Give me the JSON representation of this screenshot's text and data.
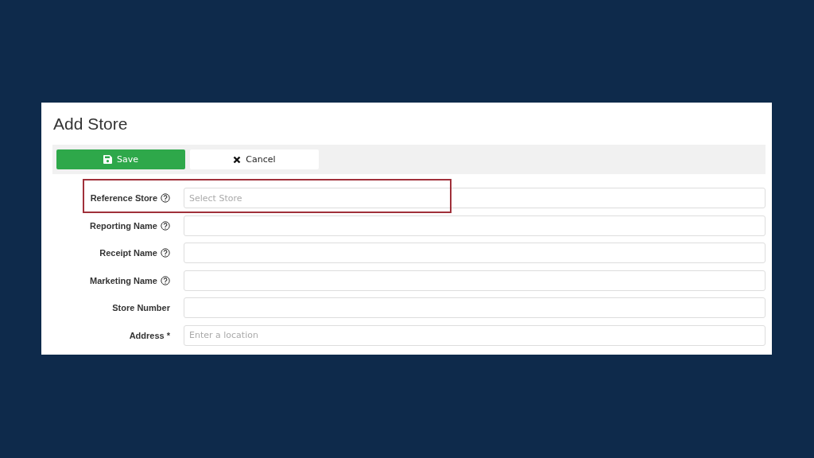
{
  "title": "Add Store",
  "toolbar": {
    "buttons": [
      {
        "kind": "save",
        "label": "Save"
      },
      {
        "kind": "cancel",
        "label": "Cancel"
      }
    ]
  },
  "fields": [
    {
      "label": "Reference Store",
      "help": true,
      "placeholder": "Select Store",
      "highlighted": true
    },
    {
      "label": "Reporting Name",
      "help": true,
      "highlighted": false
    },
    {
      "label": "Receipt Name",
      "help": true,
      "highlighted": false
    },
    {
      "label": "Marketing Name",
      "help": true,
      "highlighted": false
    },
    {
      "label": "Store Number",
      "help": false,
      "highlighted": false
    },
    {
      "label": "Address *",
      "help": false,
      "placeholder": "Enter a location",
      "highlighted": false
    }
  ]
}
